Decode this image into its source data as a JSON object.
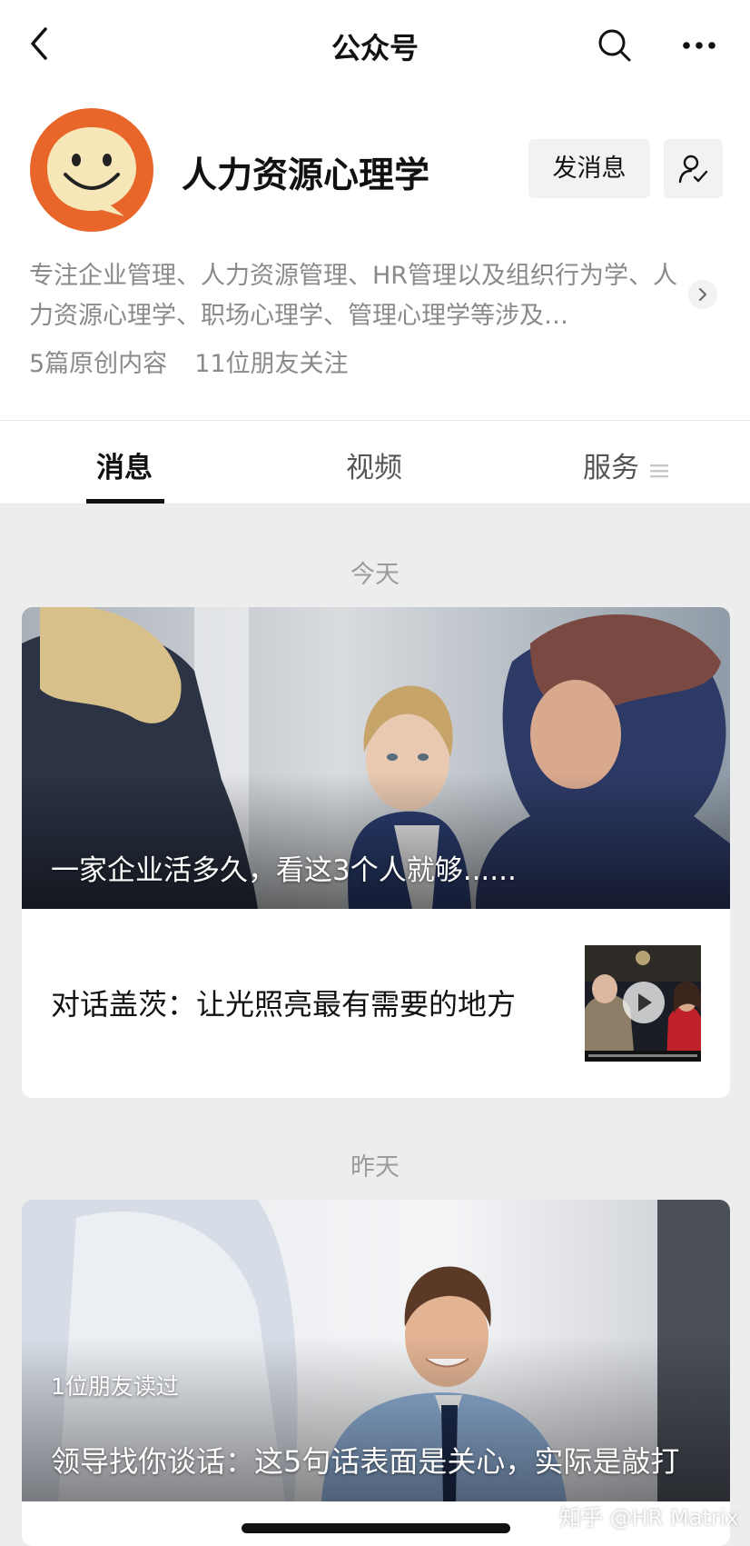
{
  "nav": {
    "title": "公众号"
  },
  "account": {
    "name": "人力资源心理学",
    "send_message_label": "发消息",
    "description": "专注企业管理、人力资源管理、HR管理以及组织行为学、人力资源心理学、职场心理学、管理心理学等涉及…",
    "original_count": "5篇原创内容",
    "friends_following": "11位朋友关注"
  },
  "tabs": {
    "messages": "消息",
    "video": "视频",
    "services": "服务"
  },
  "feed": {
    "groups": [
      {
        "date": "今天",
        "main_title": "一家企业活多久，看这3个人就够......",
        "sub_title": "对话盖茨：让光照亮最有需要的地方"
      },
      {
        "date": "昨天",
        "read_note": "1位朋友读过",
        "main_title": "领导找你谈话：这5句话表面是关心，实际是敲打"
      }
    ]
  },
  "watermark": "知乎 @HR Matrix",
  "colors": {
    "avatar_orange": "#e8662a",
    "avatar_face": "#f6e6b8",
    "secondary_text": "#8a8a8a"
  }
}
